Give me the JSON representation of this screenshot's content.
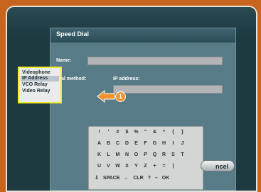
{
  "dialog": {
    "title": "Speed Dial",
    "name_label": "Name:",
    "dial_method_label": "Dial method:",
    "ip_address_label": "IP address:",
    "name_value": "",
    "ip_address_value": ""
  },
  "dial_methods": [
    "Videophone",
    "IP Address",
    "VCO Relay",
    "Video Relay"
  ],
  "selected_method": "IP Address",
  "callout": {
    "number": "1"
  },
  "keyboard": {
    "row1": [
      "!",
      "'",
      "#",
      "$",
      "%",
      "\"",
      "&",
      "*",
      "{",
      "}"
    ],
    "row2": [
      "A",
      "B",
      "C",
      "D",
      "E",
      "F",
      "G",
      "H",
      "I",
      "J"
    ],
    "row3": [
      "K",
      "L",
      "M",
      "N",
      "O",
      "P",
      "Q",
      "R",
      "S",
      "T"
    ],
    "row4": [
      "U",
      "V",
      "W",
      "X",
      "Y",
      "Z",
      "+",
      "=",
      "|",
      ""
    ],
    "bottom": {
      "shift_icon": "down-arrow-icon",
      "space": "SPACE",
      "back_icon": "left-arrow-icon",
      "clear": "CLR",
      "q": "?",
      "dash": "–",
      "ok": "OK"
    }
  },
  "cancel_label": "ncel"
}
